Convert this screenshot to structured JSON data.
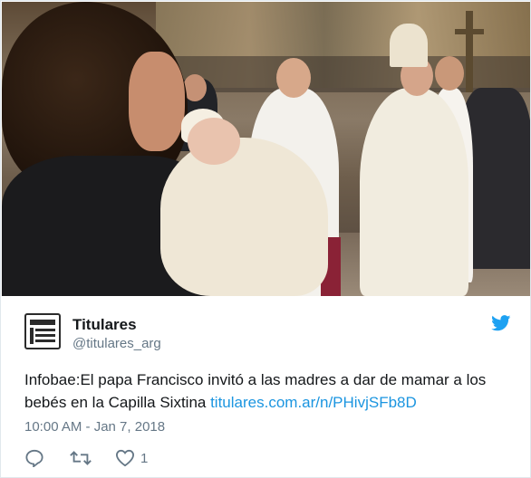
{
  "tweet": {
    "author_name": "Titulares",
    "author_handle": "@titulares_arg",
    "text": "Infobae:El papa Francisco invitó a las madres a dar de mamar a los bebés en la Capilla Sixtina ",
    "link_text": "titulares.com.ar/n/PHivjSFb8D",
    "timestamp": "10:00 AM - Jan 7, 2018",
    "like_count": "1"
  },
  "icons": {
    "avatar": "newspaper-icon",
    "brand": "twitter-bird-icon",
    "reply": "reply-icon",
    "retweet": "retweet-icon",
    "like": "heart-icon"
  },
  "colors": {
    "link": "#1b95e0",
    "brand": "#1da1f2",
    "secondary_text": "#657786",
    "primary_text": "#14171a"
  }
}
